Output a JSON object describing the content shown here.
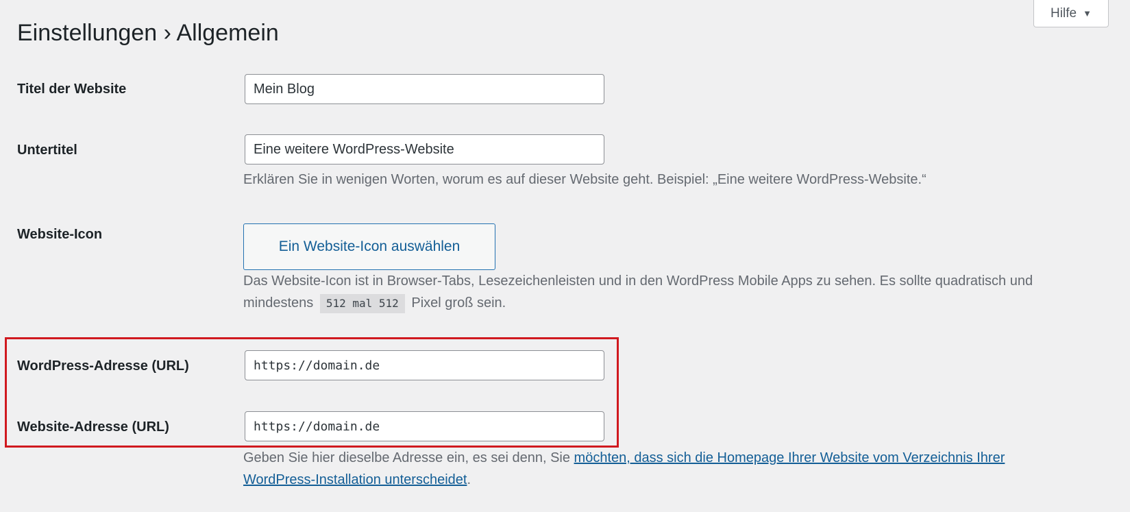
{
  "help_tab": {
    "label": "Hilfe",
    "caret_icon": "caret-down-icon"
  },
  "page": {
    "title": "Einstellungen › Allgemein"
  },
  "fields": {
    "site_title": {
      "label": "Titel der Website",
      "value": "Mein Blog"
    },
    "tagline": {
      "label": "Untertitel",
      "value": "Eine weitere WordPress-Website",
      "description": "Erklären Sie in wenigen Worten, worum es auf dieser Website geht. Beispiel: „Eine weitere WordPress-Website.“"
    },
    "site_icon": {
      "label": "Website-Icon",
      "button_label": "Ein Website-Icon auswählen",
      "description_part1": "Das Website-Icon ist in Browser-Tabs, Lesezeichenleisten und in den WordPress Mobile Apps zu sehen. Es sollte quadratisch und mindestens",
      "size_code": "512 mal 512",
      "description_part2": "Pixel groß sein."
    },
    "wordpress_address": {
      "label": "WordPress-Adresse (URL)",
      "value": "https://domain.de"
    },
    "site_address": {
      "label": "Website-Adresse (URL)",
      "value": "https://domain.de",
      "description_prefix": "Geben Sie hier dieselbe Adresse ein, es sei denn, Sie",
      "description_link": "möchten, dass sich die Homepage Ihrer Website vom Verzeichnis Ihrer WordPress-Installation unterscheidet",
      "description_suffix": "."
    }
  },
  "colors": {
    "background": "#f0f0f1",
    "highlight_border": "#d0191f",
    "link": "#135e96",
    "button_border": "#2271b1"
  }
}
